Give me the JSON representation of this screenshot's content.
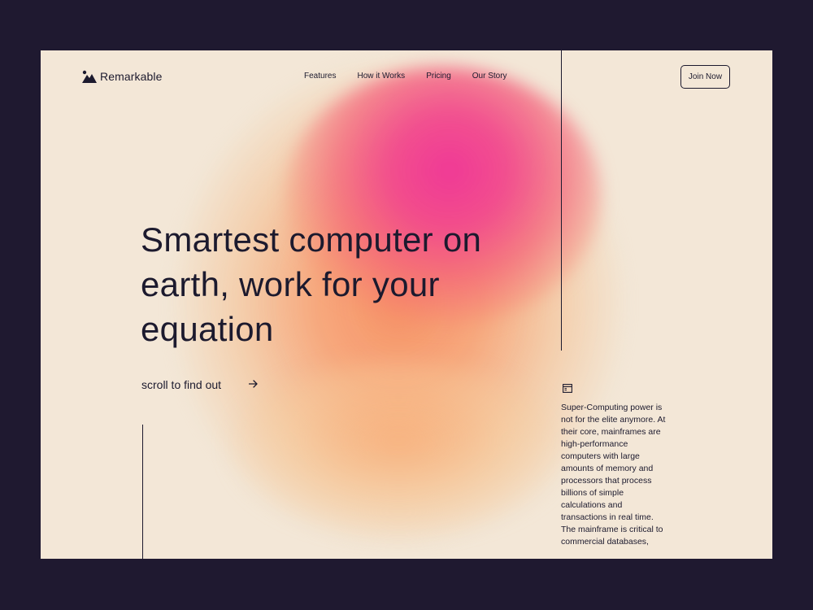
{
  "brand": {
    "name": "Remarkable",
    "logo_icon": "mountain-logo-icon"
  },
  "nav": {
    "items": [
      "Features",
      "How it Works",
      "Pricing",
      "Our Story"
    ]
  },
  "cta": {
    "join_label": "Join Now"
  },
  "hero": {
    "headline": "Smartest computer on earth, work for your equation",
    "scroll_label": "scroll to find out",
    "scroll_icon": "arrow-right-icon"
  },
  "sidebar": {
    "icon": "browser-window-icon",
    "text": "Super-Computing power is not for the elite anymore. At their core, mainframes are high-performance computers with large amounts of memory and processors that process billions of simple calculations and transactions in real time. The mainframe is critical to commercial databases,"
  },
  "colors": {
    "outer_background": "#1f1930",
    "page_background": "#f3e7d7",
    "text": "#1c1a2e",
    "gradient_pink": "#ef3696",
    "gradient_orange": "#f68e60"
  }
}
